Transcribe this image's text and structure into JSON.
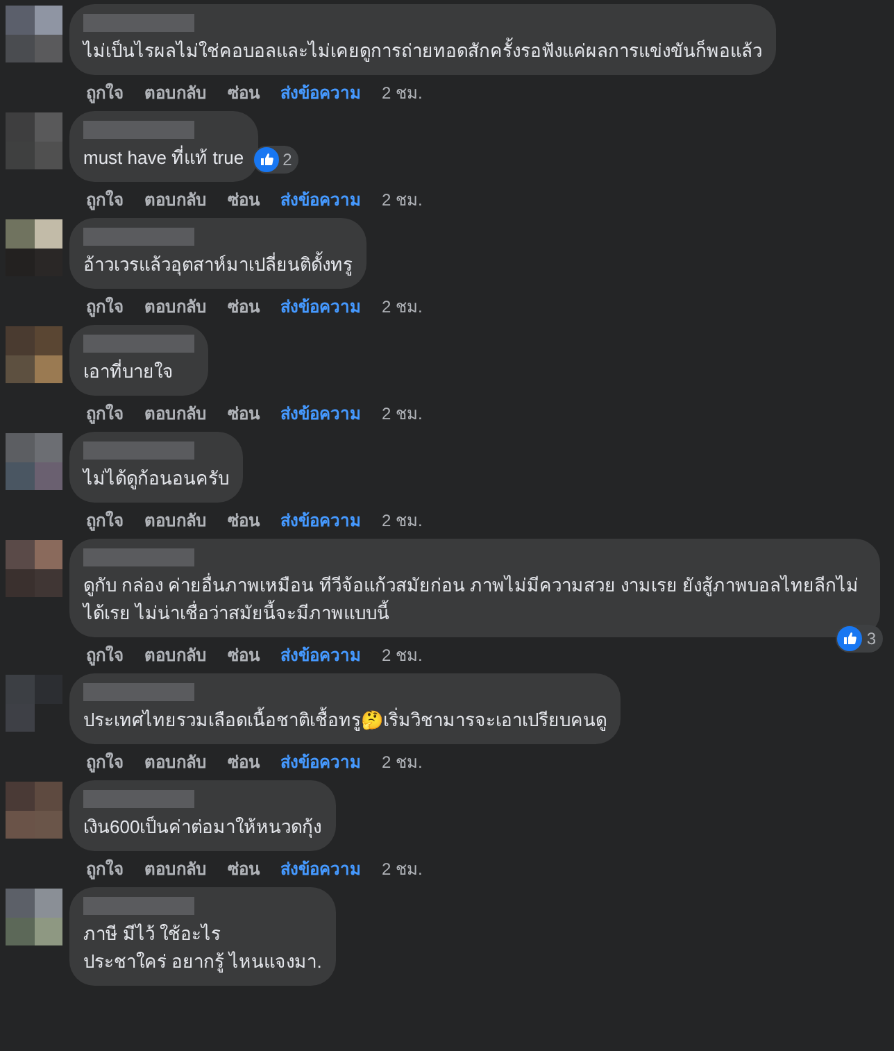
{
  "comments": [
    {
      "text": "ไม่เป็นไรผลไม่ใช่คอบอลและไม่เคยดูการถ่ายทอดสักครั้งรอฟังแค่ผลการแข่งขันก็พอแล้ว",
      "actions": [
        "ถูกใจ",
        "ตอบกลับ",
        "ซ่อน",
        "ส่งข้อความ"
      ],
      "time": "2 ชม."
    },
    {
      "text": "must have ที่แท้ true",
      "reaction": {
        "count": "2",
        "below_bubble": false
      },
      "actions": [
        "ถูกใจ",
        "ตอบกลับ",
        "ซ่อน",
        "ส่งข้อความ"
      ],
      "time": "2 ชม."
    },
    {
      "text": "อ้าวเวรแล้วอุตสาห์มาเปลี่ยนติดั้งทรู",
      "actions": [
        "ถูกใจ",
        "ตอบกลับ",
        "ซ่อน",
        "ส่งข้อความ"
      ],
      "time": "2 ชม."
    },
    {
      "text": "เอาที่บายใจ",
      "actions": [
        "ถูกใจ",
        "ตอบกลับ",
        "ซ่อน",
        "ส่งข้อความ"
      ],
      "time": "2 ชม."
    },
    {
      "text": "ไม่ได้ดูก้อนอนครับ",
      "actions": [
        "ถูกใจ",
        "ตอบกลับ",
        "ซ่อน",
        "ส่งข้อความ"
      ],
      "time": "2 ชม."
    },
    {
      "text": "ดูกับ กล่อง ค่ายอื่นภาพเหมือน ทีวีจ้อแก้วสมัยก่อน ภาพไม่มีความสวย งามเรย ยังสู้ภาพบอลไทยลีกไม่ได้เรย ไม่น่าเชื่อว่าสมัยนี้จะมีภาพแบบนี้",
      "reaction": {
        "count": "3",
        "below_bubble": true
      },
      "actions": [
        "ถูกใจ",
        "ตอบกลับ",
        "ซ่อน",
        "ส่งข้อความ"
      ],
      "time": "2 ชม."
    },
    {
      "text": "ประเทศไทยรวมเลือดเนื้อชาติเชื้อทรู🤔เริ่มวิชามารจะเอาเปรียบคนดู",
      "actions": [
        "ถูกใจ",
        "ตอบกลับ",
        "ซ่อน",
        "ส่งข้อความ"
      ],
      "time": "2 ชม."
    },
    {
      "text": "เงิน600เป็นค่าต่อมาให้หนวดกุ้ง",
      "actions": [
        "ถูกใจ",
        "ตอบกลับ",
        "ซ่อน",
        "ส่งข้อความ"
      ],
      "time": "2 ชม."
    },
    {
      "text": "ภาษี มีไว้ ใช้อะไร\nประชาใคร่ อยากรู้ ไหนแจงมา."
    }
  ]
}
